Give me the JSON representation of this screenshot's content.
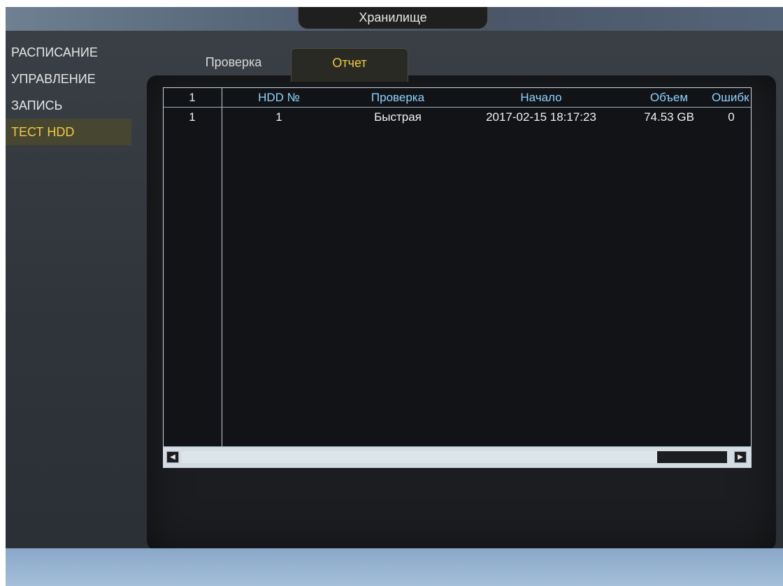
{
  "window": {
    "title": "Хранилище"
  },
  "sidebar": {
    "items": [
      {
        "label": "РАСПИСАНИЕ"
      },
      {
        "label": "УПРАВЛЕНИЕ"
      },
      {
        "label": "ЗАПИСЬ"
      },
      {
        "label": "ТЕСТ HDD",
        "active": true
      }
    ]
  },
  "tabs": [
    {
      "label": "Проверка"
    },
    {
      "label": "Отчет",
      "active": true
    }
  ],
  "table": {
    "headers": {
      "num": "1",
      "hdd": "HDD №",
      "check": "Проверка",
      "start": "Начало",
      "volume": "Объем",
      "errors": "Ошибк"
    },
    "rows": [
      {
        "num": "1",
        "hdd": "1",
        "check": "Быстрая",
        "start": "2017-02-15 18:17:23",
        "volume": "74.53 GB",
        "errors": "0"
      }
    ]
  },
  "scrollbar": {
    "left_arrow": "◀",
    "right_arrow": "▶"
  },
  "colors": {
    "accent_yellow": "#f3c843",
    "header_blue": "#8fd2ff"
  },
  "icons": {
    "scroll_left": "triangle-left-icon",
    "scroll_right": "triangle-right-icon"
  }
}
